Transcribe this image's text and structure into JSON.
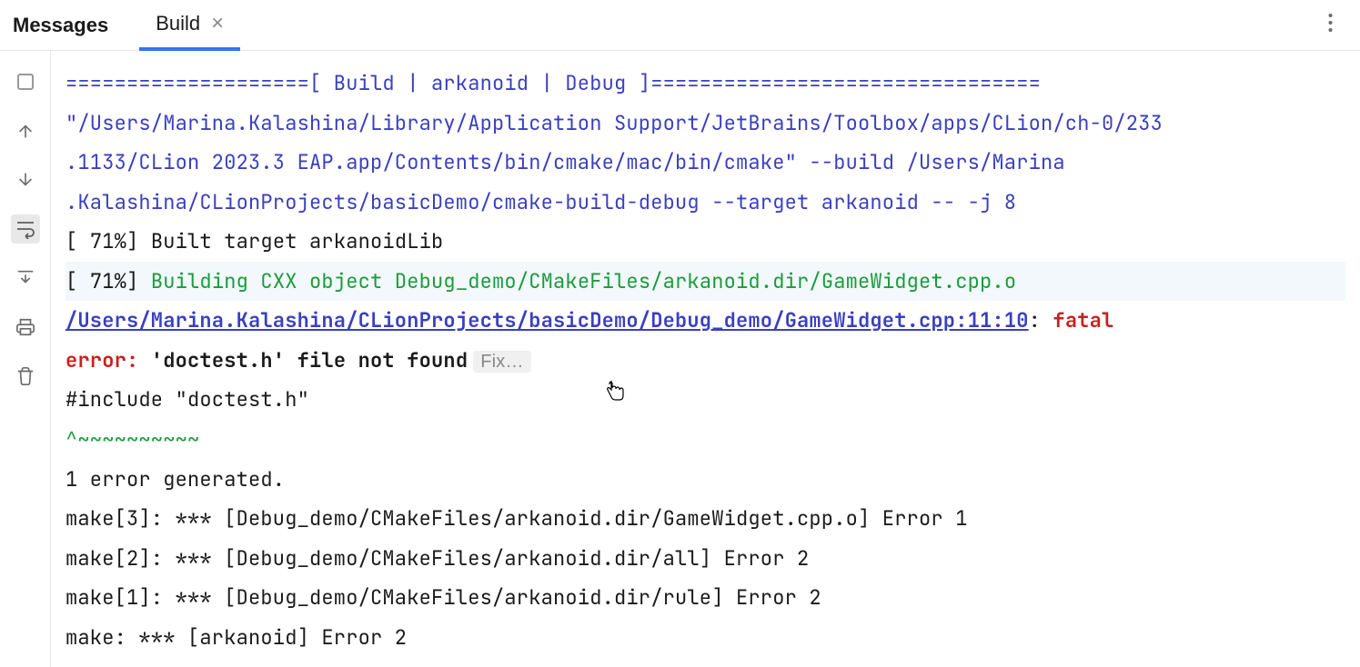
{
  "header": {
    "title": "Messages",
    "tab_label": "Build"
  },
  "output": {
    "line1": "====================[ Build | arkanoid | Debug ]================================",
    "line2": "\"/Users/Marina.Kalashina/Library/Application Support/JetBrains/Toolbox/apps/CLion/ch-0/233",
    "line3": " .1133/CLion 2023.3 EAP.app/Contents/bin/cmake/mac/bin/cmake\" --build /Users/Marina",
    "line4": " .Kalashina/CLionProjects/basicDemo/cmake-build-debug --target arkanoid -- -j 8",
    "line5_prefix": "[ 71%] ",
    "line5_rest": "Built target arkanoidLib",
    "line6_prefix": "[ 71%] ",
    "line6_cxx": "Building CXX object Debug_demo/CMakeFiles/arkanoid.dir/GameWidget.cpp.o",
    "error_path": "/Users/Marina.Kalashina/CLionProjects/basicDemo/Debug_demo/GameWidget.cpp:11:10",
    "colon": ": ",
    "fatal": "fatal",
    "error_label": " error: ",
    "error_msg": "'doctest.h' file not found",
    "fix_label": "Fix…",
    "include_line": "#include \"doctest.h\"",
    "caret_line": "         ^~~~~~~~~~~",
    "err_gen": "1 error generated.",
    "make3": "make[3]: *** [Debug_demo/CMakeFiles/arkanoid.dir/GameWidget.cpp.o] Error 1",
    "make2": "make[2]: *** [Debug_demo/CMakeFiles/arkanoid.dir/all] Error 2",
    "make1": "make[1]: *** [Debug_demo/CMakeFiles/arkanoid.dir/rule] Error 2",
    "make0": "make: *** [arkanoid] Error 2"
  }
}
